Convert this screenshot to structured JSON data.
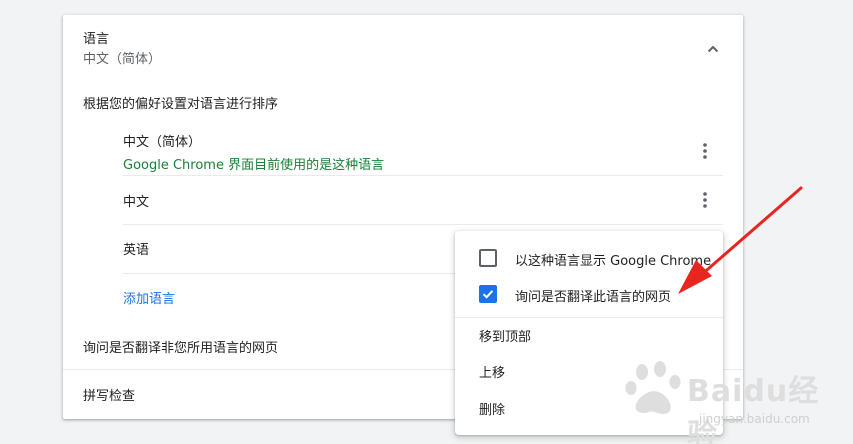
{
  "language_section": {
    "title": "语言",
    "current": "中文（简体）",
    "sort_label": "根据您的偏好设置对语言进行排序",
    "languages": [
      {
        "name": "中文（简体）",
        "note": "Google Chrome 界面目前使用的是这种语言"
      },
      {
        "name": "中文"
      },
      {
        "name": "英语"
      }
    ],
    "add_language": "添加语言",
    "offer_translate": "询问是否翻译非您所用语言的网页"
  },
  "spellcheck": {
    "label": "拼写检查"
  },
  "context_menu": {
    "display_chrome_label": "以这种语言显示 Google Chrome",
    "display_chrome_checked": false,
    "offer_translate_label": "询问是否翻译此语言的网页",
    "offer_translate_checked": true,
    "move_top": "移到顶部",
    "move_up": "上移",
    "remove": "删除"
  },
  "watermark": {
    "brand": "Baidu经验",
    "url": "jingyan.baidu.com"
  },
  "colors": {
    "accent": "#1a73e8",
    "note_green": "#188038",
    "annotation_red": "#e8261f"
  },
  "icons": {
    "collapse": "chevron-up-icon",
    "more": "more-vert-icon",
    "check": "check-icon"
  }
}
